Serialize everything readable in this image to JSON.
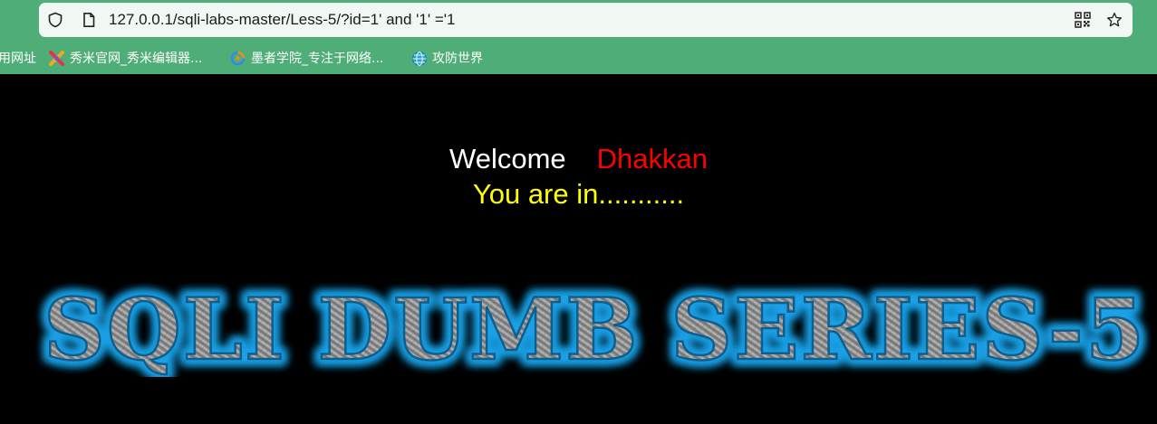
{
  "browser": {
    "url": "127.0.0.1/sqli-labs-master/Less-5/?id=1' and '1' ='1",
    "bookmarks": [
      {
        "label": "用网址",
        "icon": "none"
      },
      {
        "label": "秀米官网_秀米编辑器...",
        "icon": "xiumi-logo-icon"
      },
      {
        "label": "墨者学院_专注于网络...",
        "icon": "mozhe-logo-icon"
      },
      {
        "label": "攻防世界",
        "icon": "globe-icon"
      }
    ]
  },
  "page": {
    "welcome": "Welcome",
    "name": "Dhakkan",
    "status": "You are in...........",
    "banner": "SQLI DUMB SERIES-5"
  },
  "colors": {
    "toolbar": "#4fae78",
    "background": "#000000",
    "welcome": "#ffffff",
    "name": "#ff0000",
    "status": "#ffff00",
    "banner_glow": "#1fa0e6"
  }
}
